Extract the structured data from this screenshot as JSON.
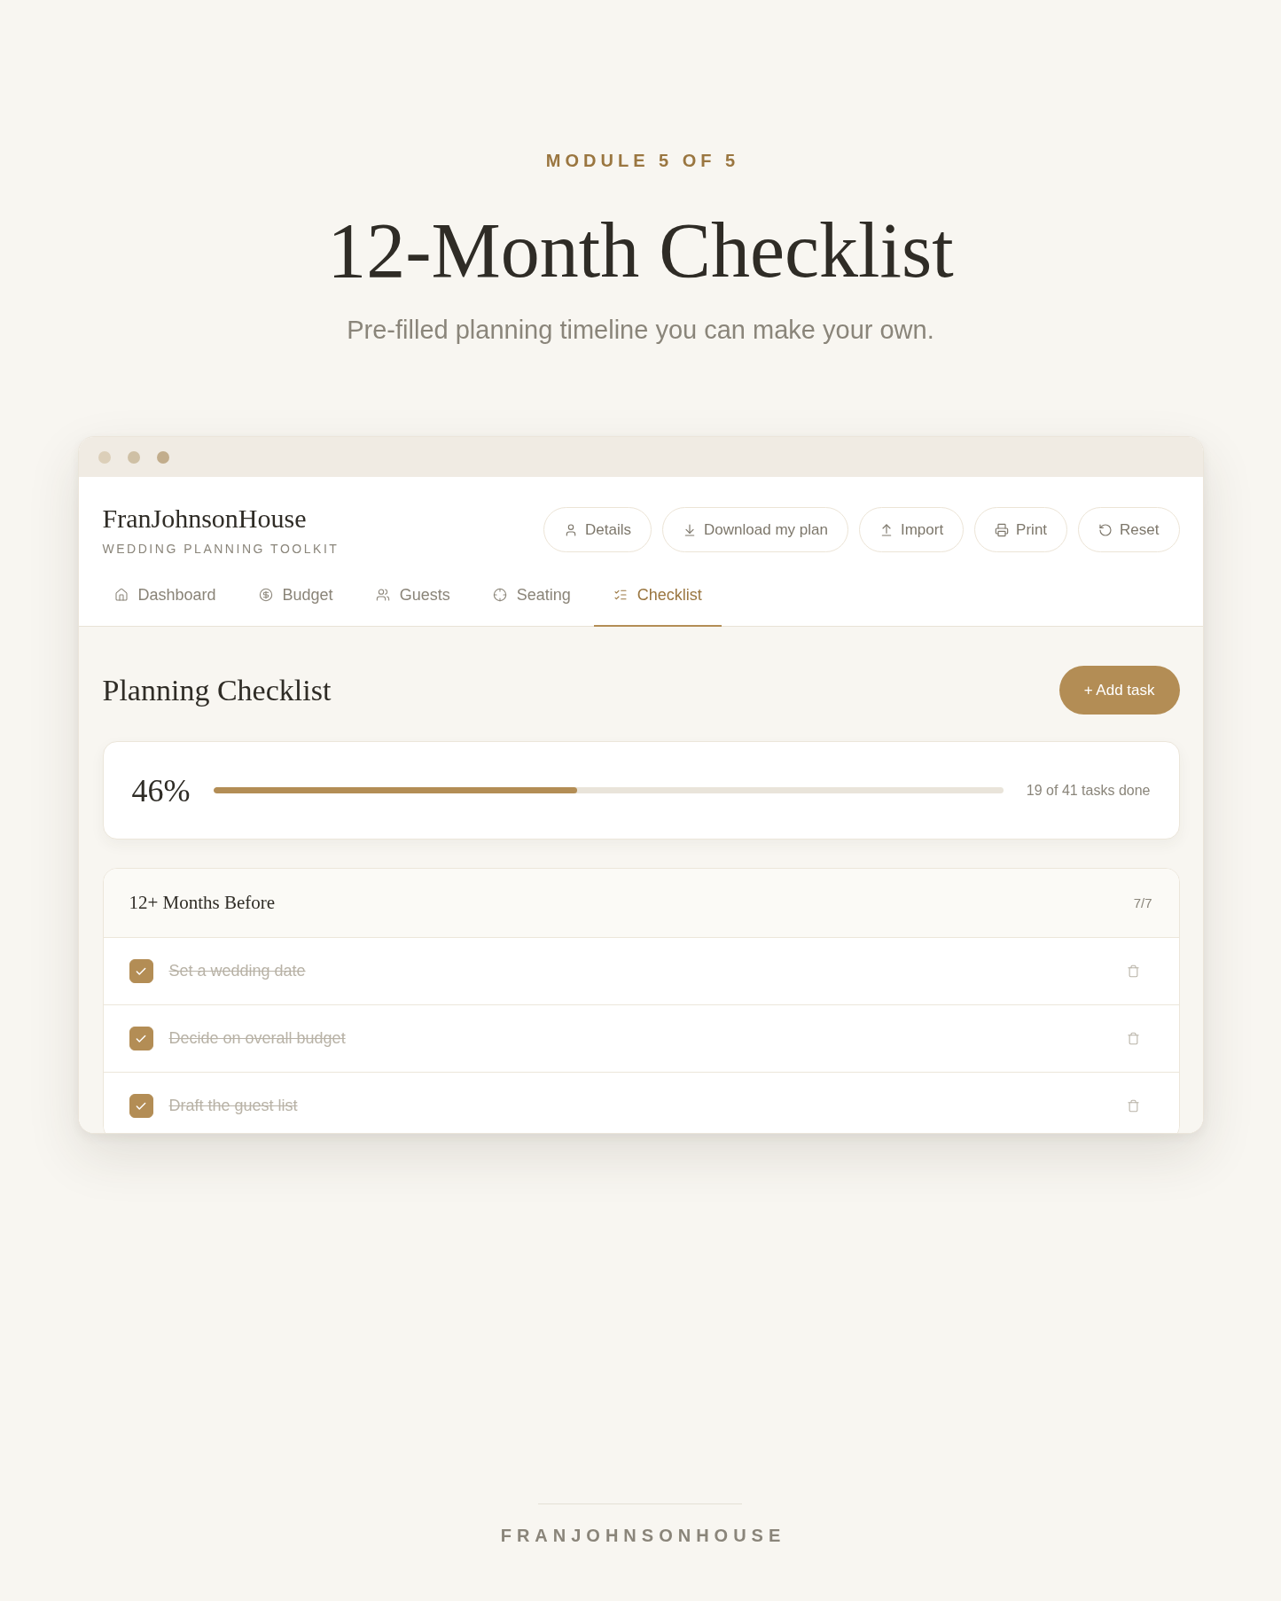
{
  "eyebrow": "MODULE 5 OF 5",
  "title": "12-Month Checklist",
  "subtitle": "Pre-filled planning timeline you can make your own.",
  "window": {
    "brand": {
      "name": "FranJohnsonHouse",
      "tagline": "WEDDING PLANNING TOOLKIT"
    },
    "actions": [
      {
        "label": "Details",
        "kind": "profile"
      },
      {
        "label": "Download my plan",
        "kind": "download"
      },
      {
        "label": "Import",
        "kind": "upload"
      },
      {
        "label": "Print",
        "kind": "print"
      },
      {
        "label": "Reset",
        "kind": "reset"
      }
    ],
    "tabs": [
      {
        "label": "Dashboard",
        "kind": "home",
        "selected": false
      },
      {
        "label": "Budget",
        "kind": "budget",
        "selected": false
      },
      {
        "label": "Guests",
        "kind": "guests",
        "selected": false
      },
      {
        "label": "Seating",
        "kind": "seating",
        "selected": false
      },
      {
        "label": "Checklist",
        "kind": "checklist",
        "selected": true
      }
    ]
  },
  "checklist": {
    "heading": "Planning Checklist",
    "add_button": "+ Add task",
    "progress": {
      "percent": "46%",
      "level": 0.46,
      "summary": "19 of 41 tasks done"
    },
    "sections": [
      {
        "title": "12+ Months Before",
        "count": "7/7",
        "tasks": [
          {
            "label": "Set a wedding date",
            "checked": true
          },
          {
            "label": "Decide on overall budget",
            "checked": true
          },
          {
            "label": "Draft the guest list",
            "checked": true
          }
        ]
      }
    ]
  },
  "footer": {
    "brand": "FRANJOHNSONHOUSE"
  }
}
